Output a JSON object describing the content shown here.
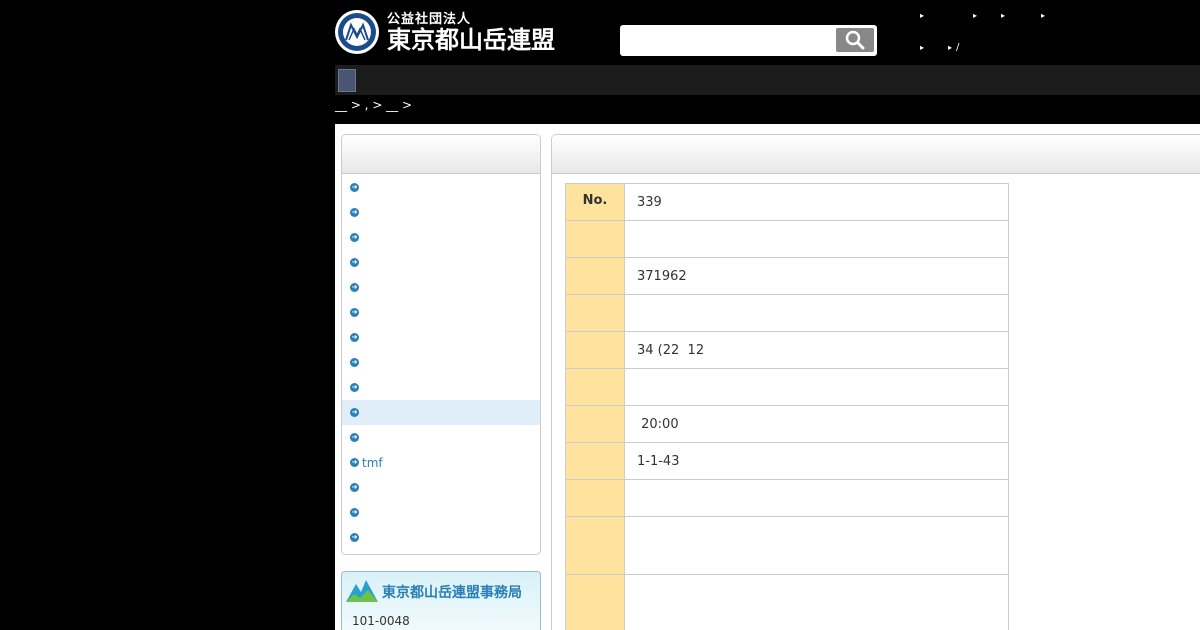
{
  "header": {
    "logo_subtitle": "公益社団法人",
    "logo_title": "東京都山岳連盟",
    "search": {
      "value": "",
      "placeholder": ""
    },
    "toplinks": {
      "row1": [
        "",
        "",
        "",
        ""
      ],
      "row2": [
        "",
        "/"
      ]
    }
  },
  "breadcrumb": "__ > , > __ >",
  "sidebar": {
    "items": [
      {
        "label": ""
      },
      {
        "label": ""
      },
      {
        "label": ""
      },
      {
        "label": ""
      },
      {
        "label": ""
      },
      {
        "label": ""
      },
      {
        "label": ""
      },
      {
        "label": ""
      },
      {
        "label": ""
      },
      {
        "label": ""
      },
      {
        "label": ""
      },
      {
        "label": "tmf"
      },
      {
        "label": ""
      },
      {
        "label": ""
      },
      {
        "label": ""
      }
    ],
    "active_index": 9
  },
  "office": {
    "title": "東京都山岳連盟事務局",
    "zip": "101-0048"
  },
  "table": {
    "rows": [
      {
        "key": "No.",
        "value": "339"
      },
      {
        "key": "",
        "value": ""
      },
      {
        "key": "",
        "value": "371962"
      },
      {
        "key": "",
        "value": ""
      },
      {
        "key": "",
        "value": "34 (22  12"
      },
      {
        "key": "",
        "value": ""
      },
      {
        "key": "",
        "value": " 20:00"
      },
      {
        "key": "",
        "value": "1-1-43"
      },
      {
        "key": "",
        "value": ""
      },
      {
        "key": "",
        "value": ""
      },
      {
        "key": "",
        "value": ""
      }
    ]
  },
  "colors": {
    "accent": "#2a7fb5",
    "table_key_bg": "#fde39e",
    "nav_bg": "#1c1c1c",
    "active_item_bg": "#dfeef9"
  }
}
